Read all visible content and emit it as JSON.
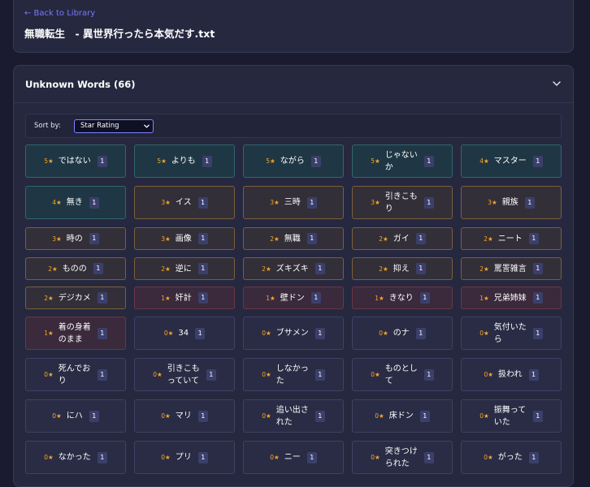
{
  "header": {
    "back_label": "← Back to Library",
    "title": "無職転生　- 異世界行ったら本気だす.txt"
  },
  "words_section": {
    "title": "Unknown Words (66)",
    "sort_label": "Sort by:",
    "sort_value": "Star Rating"
  },
  "words": [
    {
      "rating": 5,
      "stars": "5★",
      "word": "ではない",
      "count": "1"
    },
    {
      "rating": 5,
      "stars": "5★",
      "word": "よりも",
      "count": "1"
    },
    {
      "rating": 5,
      "stars": "5★",
      "word": "ながら",
      "count": "1"
    },
    {
      "rating": 5,
      "stars": "5★",
      "word": "じゃないか",
      "count": "1"
    },
    {
      "rating": 4,
      "stars": "4★",
      "word": "マスター",
      "count": "1"
    },
    {
      "rating": 4,
      "stars": "4★",
      "word": "無き",
      "count": "1"
    },
    {
      "rating": 3,
      "stars": "3★",
      "word": "イス",
      "count": "1"
    },
    {
      "rating": 3,
      "stars": "3★",
      "word": "三時",
      "count": "1"
    },
    {
      "rating": 3,
      "stars": "3★",
      "word": "引きこもり",
      "count": "1"
    },
    {
      "rating": 3,
      "stars": "3★",
      "word": "親族",
      "count": "1"
    },
    {
      "rating": 3,
      "stars": "3★",
      "word": "時の",
      "count": "1"
    },
    {
      "rating": 3,
      "stars": "3★",
      "word": "画像",
      "count": "1"
    },
    {
      "rating": 2,
      "stars": "2★",
      "word": "無職",
      "count": "1"
    },
    {
      "rating": 2,
      "stars": "2★",
      "word": "ガイ",
      "count": "1"
    },
    {
      "rating": 2,
      "stars": "2★",
      "word": "ニート",
      "count": "1"
    },
    {
      "rating": 2,
      "stars": "2★",
      "word": "ものの",
      "count": "1"
    },
    {
      "rating": 2,
      "stars": "2★",
      "word": "逆に",
      "count": "1"
    },
    {
      "rating": 2,
      "stars": "2★",
      "word": "ズキズキ",
      "count": "1"
    },
    {
      "rating": 2,
      "stars": "2★",
      "word": "抑え",
      "count": "1"
    },
    {
      "rating": 2,
      "stars": "2★",
      "word": "罵詈雑言",
      "count": "1"
    },
    {
      "rating": 2,
      "stars": "2★",
      "word": "デジカメ",
      "count": "1"
    },
    {
      "rating": 1,
      "stars": "1★",
      "word": "奸計",
      "count": "1"
    },
    {
      "rating": 1,
      "stars": "1★",
      "word": "壁ドン",
      "count": "1"
    },
    {
      "rating": 1,
      "stars": "1★",
      "word": "きなり",
      "count": "1"
    },
    {
      "rating": 1,
      "stars": "1★",
      "word": "兄弟姉妹",
      "count": "1"
    },
    {
      "rating": 1,
      "stars": "1★",
      "word": "着の身着のまま",
      "count": "1"
    },
    {
      "rating": 0,
      "stars": "0★",
      "word": "34",
      "count": "1"
    },
    {
      "rating": 0,
      "stars": "0★",
      "word": "ブサメン",
      "count": "1"
    },
    {
      "rating": 0,
      "stars": "0★",
      "word": "のナ",
      "count": "1"
    },
    {
      "rating": 0,
      "stars": "0★",
      "word": "気付いたら",
      "count": "1"
    },
    {
      "rating": 0,
      "stars": "0★",
      "word": "死んでおり",
      "count": "1"
    },
    {
      "rating": 0,
      "stars": "0★",
      "word": "引きこもっていて",
      "count": "1"
    },
    {
      "rating": 0,
      "stars": "0★",
      "word": "しなかった",
      "count": "1"
    },
    {
      "rating": 0,
      "stars": "0★",
      "word": "ものとして",
      "count": "1"
    },
    {
      "rating": 0,
      "stars": "0★",
      "word": "扱われ",
      "count": "1"
    },
    {
      "rating": 0,
      "stars": "0★",
      "word": "にハ",
      "count": "1"
    },
    {
      "rating": 0,
      "stars": "0★",
      "word": "マリ",
      "count": "1"
    },
    {
      "rating": 0,
      "stars": "0★",
      "word": "追い出された",
      "count": "1"
    },
    {
      "rating": 0,
      "stars": "0★",
      "word": "床ドン",
      "count": "1"
    },
    {
      "rating": 0,
      "stars": "0★",
      "word": "振舞っていた",
      "count": "1"
    },
    {
      "rating": 0,
      "stars": "0★",
      "word": "なかった",
      "count": "1"
    },
    {
      "rating": 0,
      "stars": "0★",
      "word": "プリ",
      "count": "1"
    },
    {
      "rating": 0,
      "stars": "0★",
      "word": "ニー",
      "count": "1"
    },
    {
      "rating": 0,
      "stars": "0★",
      "word": "突きつけられた",
      "count": "1"
    },
    {
      "rating": 0,
      "stars": "0★",
      "word": "がった",
      "count": "1"
    }
  ]
}
